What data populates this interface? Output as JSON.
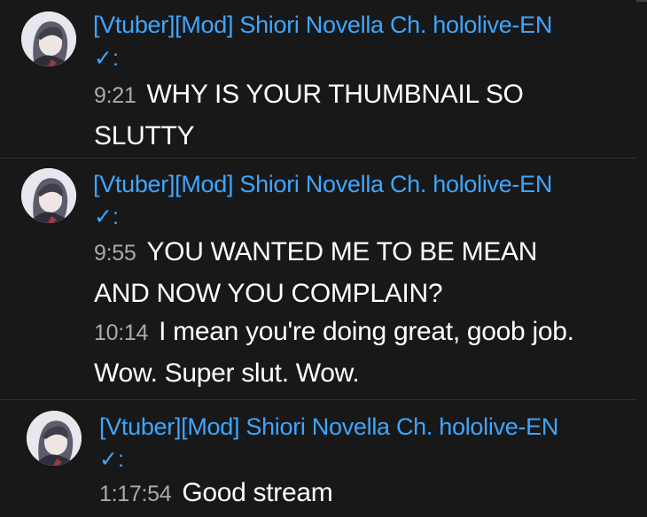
{
  "chat": {
    "messages": [
      {
        "author": "[Vtuber][Mod] Shiori Novella Ch. hololive-EN",
        "verified": "✓:",
        "lines": [
          {
            "timestamp": "9:21",
            "text": "WHY IS YOUR THUMBNAIL SO SLUTTY"
          }
        ]
      },
      {
        "author": "[Vtuber][Mod] Shiori Novella Ch. hololive-EN",
        "verified": "✓:",
        "lines": [
          {
            "timestamp": "9:55",
            "text": "YOU WANTED ME TO BE MEAN AND NOW YOU COMPLAIN?"
          },
          {
            "timestamp": "10:14",
            "text": "I mean you're doing great, goob job. Wow. Super slut. Wow."
          }
        ]
      },
      {
        "author": "[Vtuber][Mod] Shiori Novella Ch. hololive-EN",
        "verified": "✓:",
        "lines": [
          {
            "timestamp": "1:17:54",
            "text": "Good stream"
          }
        ]
      }
    ],
    "colors": {
      "background": "#181818",
      "author": "#3ea6ff",
      "timestamp": "#aaaaaa",
      "message": "#ffffff"
    },
    "icons": [
      "avatar",
      "verified-check-icon"
    ]
  }
}
